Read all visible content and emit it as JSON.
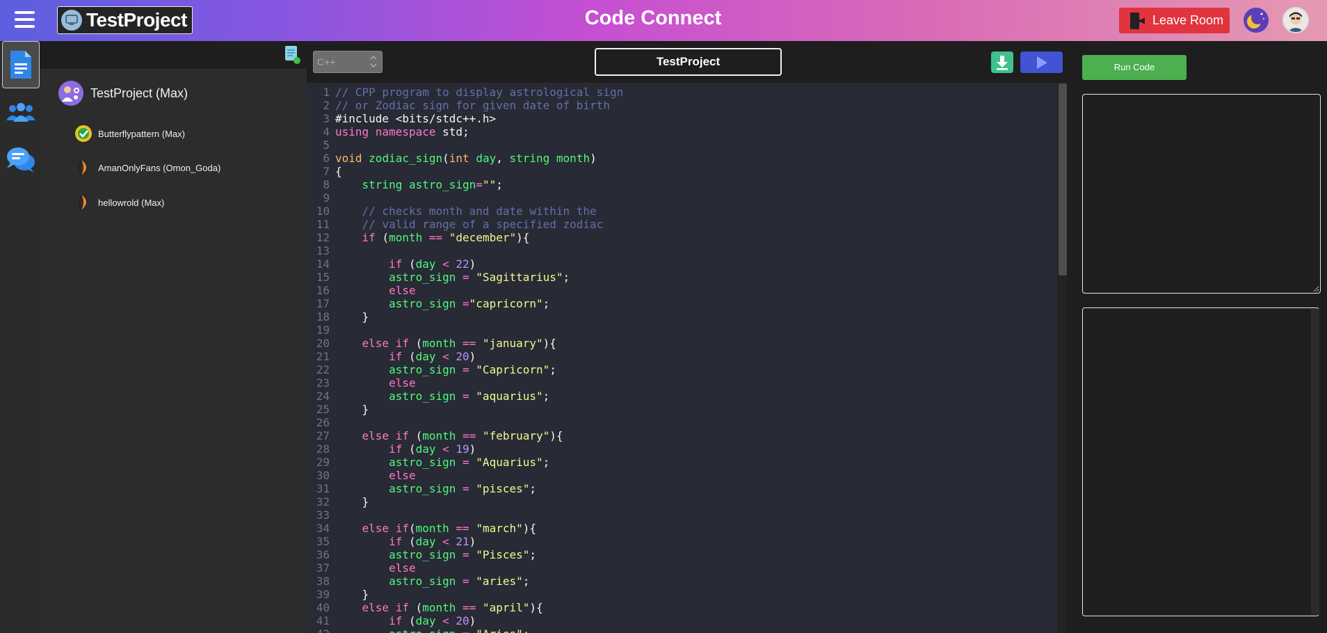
{
  "header": {
    "project_name": "TestProject",
    "app_title": "Code Connect",
    "leave_label": "Leave Room"
  },
  "sidebar": {
    "items": [
      {
        "name": "files",
        "icon": "document-icon",
        "active": true
      },
      {
        "name": "participants",
        "icon": "users-icon",
        "active": false
      },
      {
        "name": "chat",
        "icon": "chat-icon",
        "active": false
      }
    ]
  },
  "explorer": {
    "folder": "TestProject (Max)",
    "files": [
      {
        "label": "Butterflypattern (Max)",
        "icon": "check-badge-icon"
      },
      {
        "label": "AmanOnlyFans (Omon_Goda)",
        "icon": "leaf-icon"
      },
      {
        "label": "hellowrold (Max)",
        "icon": "leaf-icon"
      }
    ]
  },
  "editor": {
    "language": "C++",
    "filename": "TestProject"
  },
  "right_panel": {
    "run_label": "Run Code"
  },
  "colors": {
    "accent_green": "#4caf50",
    "leave_red": "#e1343f",
    "play_blue": "#4253d4",
    "download_green": "#3ec18b",
    "editor_bg": "#282a36"
  },
  "code": {
    "language": "cpp",
    "lines": [
      [
        [
          "t-cm",
          "// CPP program to display astrological sign"
        ]
      ],
      [
        [
          "t-cm",
          "// or Zodiac sign for given date of birth"
        ]
      ],
      [
        [
          "t-pl",
          "#include <bits/stdc++.h>"
        ]
      ],
      [
        [
          "t-kw",
          "using namespace "
        ],
        [
          "t-pl",
          "std;"
        ]
      ],
      [],
      [
        [
          "t-ty",
          "void "
        ],
        [
          "t-fn",
          "zodiac_sign"
        ],
        [
          "t-pl",
          "("
        ],
        [
          "t-ty",
          "int "
        ],
        [
          "t-va",
          "day"
        ],
        [
          "t-pl",
          ", "
        ],
        [
          "t-va",
          "string month"
        ],
        [
          "t-pl",
          ")"
        ]
      ],
      [
        [
          "t-pl",
          "{"
        ]
      ],
      [
        [
          "t-pl",
          "    "
        ],
        [
          "t-va",
          "string astro_sign"
        ],
        [
          "t-kw",
          "="
        ],
        [
          "t-st",
          "\"\""
        ],
        [
          "t-pl",
          ";"
        ]
      ],
      [],
      [
        [
          "t-pl",
          "    "
        ],
        [
          "t-cm",
          "// checks month and date within the"
        ]
      ],
      [
        [
          "t-pl",
          "    "
        ],
        [
          "t-cm",
          "// valid range of a specified zodiac"
        ]
      ],
      [
        [
          "t-pl",
          "    "
        ],
        [
          "t-kw",
          "if "
        ],
        [
          "t-pl",
          "("
        ],
        [
          "t-va",
          "month "
        ],
        [
          "t-kw",
          "== "
        ],
        [
          "t-st",
          "\"december\""
        ],
        [
          "t-pl",
          "){"
        ]
      ],
      [],
      [
        [
          "t-pl",
          "        "
        ],
        [
          "t-kw",
          "if "
        ],
        [
          "t-pl",
          "("
        ],
        [
          "t-va",
          "day "
        ],
        [
          "t-kw",
          "< "
        ],
        [
          "t-nu",
          "22"
        ],
        [
          "t-pl",
          ")"
        ]
      ],
      [
        [
          "t-pl",
          "        "
        ],
        [
          "t-va",
          "astro_sign "
        ],
        [
          "t-kw",
          "= "
        ],
        [
          "t-st",
          "\"Sagittarius\""
        ],
        [
          "t-pl",
          ";"
        ]
      ],
      [
        [
          "t-pl",
          "        "
        ],
        [
          "t-kw",
          "else"
        ]
      ],
      [
        [
          "t-pl",
          "        "
        ],
        [
          "t-va",
          "astro_sign "
        ],
        [
          "t-kw",
          "="
        ],
        [
          "t-st",
          "\"capricorn\""
        ],
        [
          "t-pl",
          ";"
        ]
      ],
      [
        [
          "t-pl",
          "    }"
        ]
      ],
      [],
      [
        [
          "t-pl",
          "    "
        ],
        [
          "t-kw",
          "else if "
        ],
        [
          "t-pl",
          "("
        ],
        [
          "t-va",
          "month "
        ],
        [
          "t-kw",
          "== "
        ],
        [
          "t-st",
          "\"january\""
        ],
        [
          "t-pl",
          "){"
        ]
      ],
      [
        [
          "t-pl",
          "        "
        ],
        [
          "t-kw",
          "if "
        ],
        [
          "t-pl",
          "("
        ],
        [
          "t-va",
          "day "
        ],
        [
          "t-kw",
          "< "
        ],
        [
          "t-nu",
          "20"
        ],
        [
          "t-pl",
          ")"
        ]
      ],
      [
        [
          "t-pl",
          "        "
        ],
        [
          "t-va",
          "astro_sign "
        ],
        [
          "t-kw",
          "= "
        ],
        [
          "t-st",
          "\"Capricorn\""
        ],
        [
          "t-pl",
          ";"
        ]
      ],
      [
        [
          "t-pl",
          "        "
        ],
        [
          "t-kw",
          "else"
        ]
      ],
      [
        [
          "t-pl",
          "        "
        ],
        [
          "t-va",
          "astro_sign "
        ],
        [
          "t-kw",
          "= "
        ],
        [
          "t-st",
          "\"aquarius\""
        ],
        [
          "t-pl",
          ";"
        ]
      ],
      [
        [
          "t-pl",
          "    }"
        ]
      ],
      [],
      [
        [
          "t-pl",
          "    "
        ],
        [
          "t-kw",
          "else if "
        ],
        [
          "t-pl",
          "("
        ],
        [
          "t-va",
          "month "
        ],
        [
          "t-kw",
          "== "
        ],
        [
          "t-st",
          "\"february\""
        ],
        [
          "t-pl",
          "){"
        ]
      ],
      [
        [
          "t-pl",
          "        "
        ],
        [
          "t-kw",
          "if "
        ],
        [
          "t-pl",
          "("
        ],
        [
          "t-va",
          "day "
        ],
        [
          "t-kw",
          "< "
        ],
        [
          "t-nu",
          "19"
        ],
        [
          "t-pl",
          ")"
        ]
      ],
      [
        [
          "t-pl",
          "        "
        ],
        [
          "t-va",
          "astro_sign "
        ],
        [
          "t-kw",
          "= "
        ],
        [
          "t-st",
          "\"Aquarius\""
        ],
        [
          "t-pl",
          ";"
        ]
      ],
      [
        [
          "t-pl",
          "        "
        ],
        [
          "t-kw",
          "else"
        ]
      ],
      [
        [
          "t-pl",
          "        "
        ],
        [
          "t-va",
          "astro_sign "
        ],
        [
          "t-kw",
          "= "
        ],
        [
          "t-st",
          "\"pisces\""
        ],
        [
          "t-pl",
          ";"
        ]
      ],
      [
        [
          "t-pl",
          "    }"
        ]
      ],
      [],
      [
        [
          "t-pl",
          "    "
        ],
        [
          "t-kw",
          "else if"
        ],
        [
          "t-pl",
          "("
        ],
        [
          "t-va",
          "month "
        ],
        [
          "t-kw",
          "== "
        ],
        [
          "t-st",
          "\"march\""
        ],
        [
          "t-pl",
          "){"
        ]
      ],
      [
        [
          "t-pl",
          "        "
        ],
        [
          "t-kw",
          "if "
        ],
        [
          "t-pl",
          "("
        ],
        [
          "t-va",
          "day "
        ],
        [
          "t-kw",
          "< "
        ],
        [
          "t-nu",
          "21"
        ],
        [
          "t-pl",
          ")"
        ]
      ],
      [
        [
          "t-pl",
          "        "
        ],
        [
          "t-va",
          "astro_sign "
        ],
        [
          "t-kw",
          "= "
        ],
        [
          "t-st",
          "\"Pisces\""
        ],
        [
          "t-pl",
          ";"
        ]
      ],
      [
        [
          "t-pl",
          "        "
        ],
        [
          "t-kw",
          "else"
        ]
      ],
      [
        [
          "t-pl",
          "        "
        ],
        [
          "t-va",
          "astro_sign "
        ],
        [
          "t-kw",
          "= "
        ],
        [
          "t-st",
          "\"aries\""
        ],
        [
          "t-pl",
          ";"
        ]
      ],
      [
        [
          "t-pl",
          "    }"
        ]
      ],
      [
        [
          "t-pl",
          "    "
        ],
        [
          "t-kw",
          "else if "
        ],
        [
          "t-pl",
          "("
        ],
        [
          "t-va",
          "month "
        ],
        [
          "t-kw",
          "== "
        ],
        [
          "t-st",
          "\"april\""
        ],
        [
          "t-pl",
          "){"
        ]
      ],
      [
        [
          "t-pl",
          "        "
        ],
        [
          "t-kw",
          "if "
        ],
        [
          "t-pl",
          "("
        ],
        [
          "t-va",
          "day "
        ],
        [
          "t-kw",
          "< "
        ],
        [
          "t-nu",
          "20"
        ],
        [
          "t-pl",
          ")"
        ]
      ],
      [
        [
          "t-pl",
          "        "
        ],
        [
          "t-va",
          "astro_sign "
        ],
        [
          "t-kw",
          "= "
        ],
        [
          "t-st",
          "\"Aries\""
        ],
        [
          "t-pl",
          ";"
        ]
      ]
    ]
  }
}
